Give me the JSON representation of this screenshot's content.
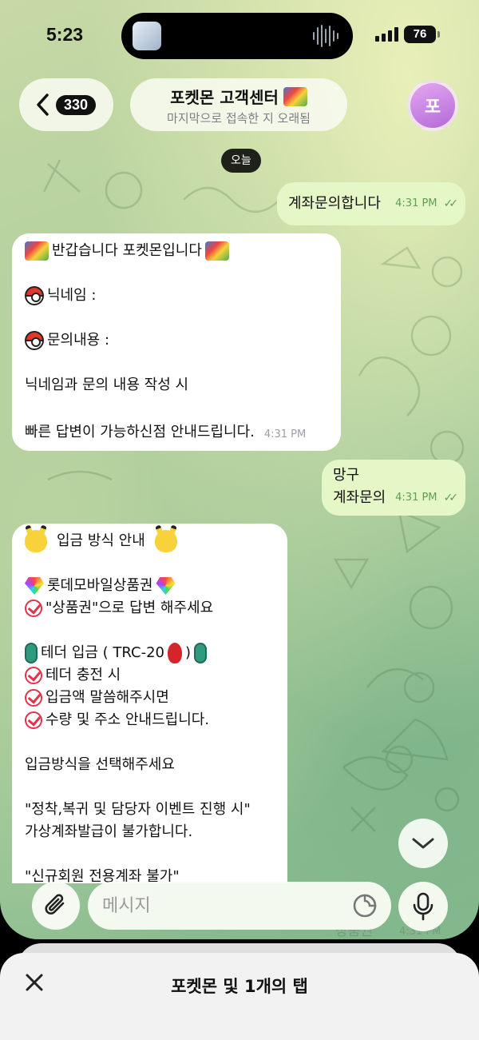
{
  "status_bar": {
    "time": "5:23",
    "battery": "76"
  },
  "header": {
    "unread_count": "330",
    "title": "포켓몬 고객센터",
    "subtitle": "마지막으로 접속한 지 오래됨",
    "avatar_letter": "포"
  },
  "date_chip": "오늘",
  "messages": {
    "m1": {
      "text": "계좌문의합니다",
      "time": "4:31 PM"
    },
    "m2": {
      "greeting": "반갑습니다 포켓몬입니다",
      "nickname": "닉네임 :",
      "inquiry": "문의내용 :",
      "line3": "닉네임과 문의 내용 작성 시",
      "line4": "빠른 답변이 가능하신점 안내드립니다.",
      "time": "4:31 PM"
    },
    "m3": {
      "line1": "망구",
      "line2": "계좌문의",
      "time": "4:31 PM"
    },
    "m4": {
      "heading": "입금 방식 안내",
      "giftcard": "롯데모바일상품권",
      "giftcard_note": "\"상품권\"으로 답변 해주세요",
      "tether_prefix": "테더 입금 ( TRC-20",
      "tether_suffix": ")",
      "tether1": "테더 충전 시",
      "tether2": "입금액 말씀해주시면",
      "tether3": "수량 및 주소 안내드립니다.",
      "select": "입금방식을 선택해주세요",
      "notice1": "\"정착,복귀 및 담당자 이벤트 진행 시\"",
      "notice2": "가상계좌발급이 불가합니다.",
      "notice3": "\"신규회원 전용계좌 불가\""
    }
  },
  "composer": {
    "placeholder": "메시지"
  },
  "peek": {
    "text": "상품권",
    "time": "4:31 PM"
  },
  "tab_sheet": {
    "title": "포켓몬 및 1개의 탭"
  }
}
